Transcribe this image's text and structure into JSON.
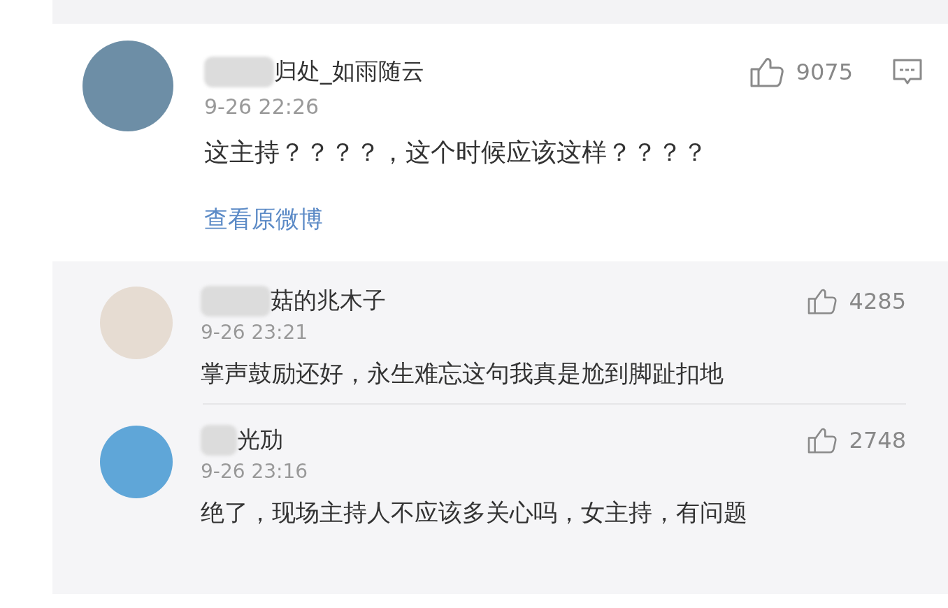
{
  "main_comment": {
    "author": "归处_如雨随云",
    "time": "9-26 22:26",
    "likes": "9075",
    "text": "这主持？？？？，这个时候应该这样？？？？",
    "link": "查看原微博"
  },
  "replies": [
    {
      "author": "菇的兆木子",
      "time": "9-26 23:21",
      "likes": "4285",
      "text": "掌声鼓励还好，永生难忘这句我真是尬到脚趾扣地"
    },
    {
      "author": "光劢",
      "time": "9-26 23:16",
      "likes": "2748",
      "text": "绝了，现场主持人不应该多关心吗，女主持，有问题"
    }
  ]
}
